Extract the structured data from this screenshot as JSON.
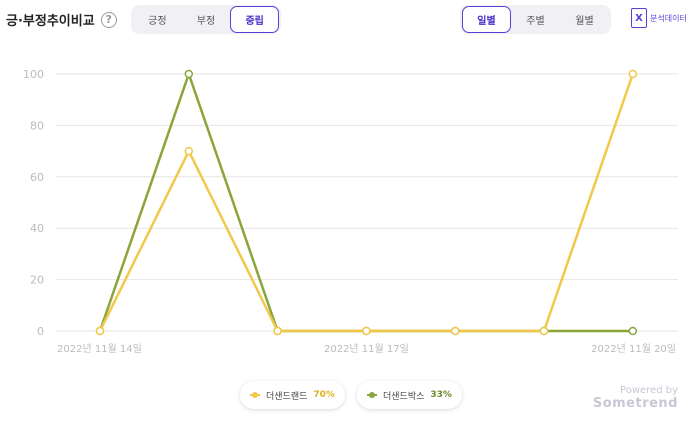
{
  "header": {
    "title": "긍·부정추이비교",
    "help_icon": "question-circle-icon"
  },
  "sentiment_tabs": [
    {
      "label": "긍정",
      "active": false
    },
    {
      "label": "부정",
      "active": false
    },
    {
      "label": "중립",
      "active": true
    }
  ],
  "period_tabs": [
    {
      "label": "일별",
      "active": true
    },
    {
      "label": "주별",
      "active": false
    },
    {
      "label": "월별",
      "active": false
    }
  ],
  "export": {
    "label": "분석데이터",
    "icon": "excel-icon"
  },
  "colors": {
    "accent": "#5a3fd8",
    "series1": "#f0c94a",
    "series2": "#8aa53a",
    "grid": "#e6e6e6",
    "axis_text": "#bbbbbb"
  },
  "chart_data": {
    "type": "line",
    "x": [
      "2022-11-14",
      "2022-11-15",
      "2022-11-16",
      "2022-11-17",
      "2022-11-18",
      "2022-11-19",
      "2022-11-20"
    ],
    "x_tick_labels": [
      "2022년 11월 14일",
      "",
      "",
      "2022년 11월 17일",
      "",
      "",
      "2022년 11월 20일"
    ],
    "ylim": [
      0,
      100
    ],
    "yticks": [
      0,
      20,
      40,
      60,
      80,
      100
    ],
    "grid": true,
    "legend_position": "bottom-center",
    "series": [
      {
        "name": "더샌드랜드",
        "share": "70%",
        "color": "#f0c94a",
        "values": [
          0,
          70,
          0,
          0,
          0,
          0,
          100
        ]
      },
      {
        "name": "더샌드박스",
        "share": "33%",
        "color": "#8aa53a",
        "values": [
          0,
          100,
          0,
          0,
          0,
          0,
          0
        ]
      }
    ]
  },
  "footer": {
    "powered_by": "Powered by",
    "brand": "Sometrend"
  }
}
